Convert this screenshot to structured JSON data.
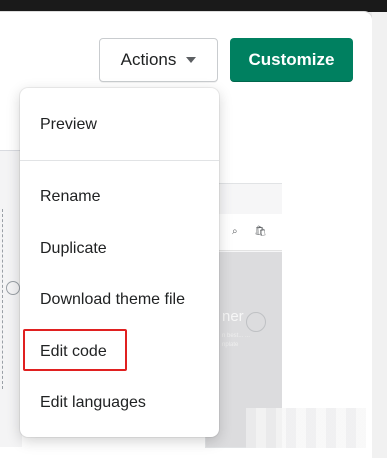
{
  "header": {
    "actions_label": "Actions",
    "customize_label": "Customize"
  },
  "menu": {
    "items": [
      {
        "label": "Preview"
      },
      {
        "label": "Rename"
      },
      {
        "label": "Duplicate"
      },
      {
        "label": "Download theme file"
      },
      {
        "label": "Edit code",
        "highlighted": true
      },
      {
        "label": "Edit languages"
      }
    ]
  },
  "background_preview": {
    "hero_text": "ner",
    "hero_subtext": "n best... ... nplate"
  },
  "colors": {
    "primary_button": "#008060",
    "highlight_outline": "#e02020"
  },
  "icons": {
    "dropdown": "caret-down-icon",
    "search": "search-icon",
    "cart": "cart-icon"
  }
}
